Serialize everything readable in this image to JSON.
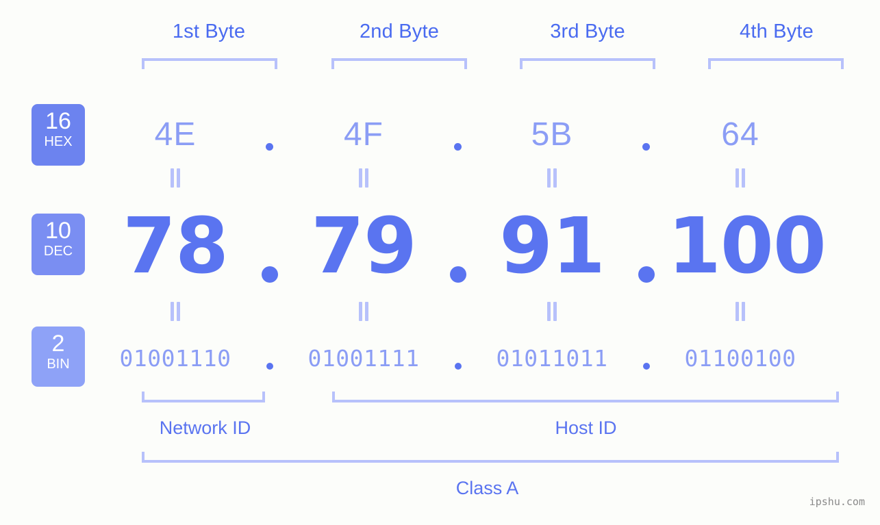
{
  "header": {
    "byte_labels": [
      "1st Byte",
      "2nd Byte",
      "3rd Byte",
      "4th Byte"
    ]
  },
  "bases": [
    {
      "number": "16",
      "name": "HEX",
      "color": "#6c83ef"
    },
    {
      "number": "10",
      "name": "DEC",
      "color": "#7a8ef2"
    },
    {
      "number": "2",
      "name": "BIN",
      "color": "#8ea2f7"
    }
  ],
  "values": {
    "hex": [
      "4E",
      "4F",
      "5B",
      "64"
    ],
    "dec": [
      "78",
      "79",
      "91",
      "100"
    ],
    "bin": [
      "01001110",
      "01001111",
      "01011011",
      "01100100"
    ],
    "separator": "."
  },
  "equals_symbol": "=",
  "sections": {
    "network_id": "Network ID",
    "host_id": "Host ID",
    "class": "Class A"
  },
  "watermark": "ipshu.com",
  "colors": {
    "background": "#fcfdfa",
    "primary_blue": "#5a74f0",
    "light_blue": "#8b9df5",
    "bracket": "#b7c1fb",
    "badge_hex": "#6c83ef",
    "badge_dec": "#7a8ef2",
    "badge_bin": "#8ea2f7",
    "watermark": "#8a8a8a"
  }
}
